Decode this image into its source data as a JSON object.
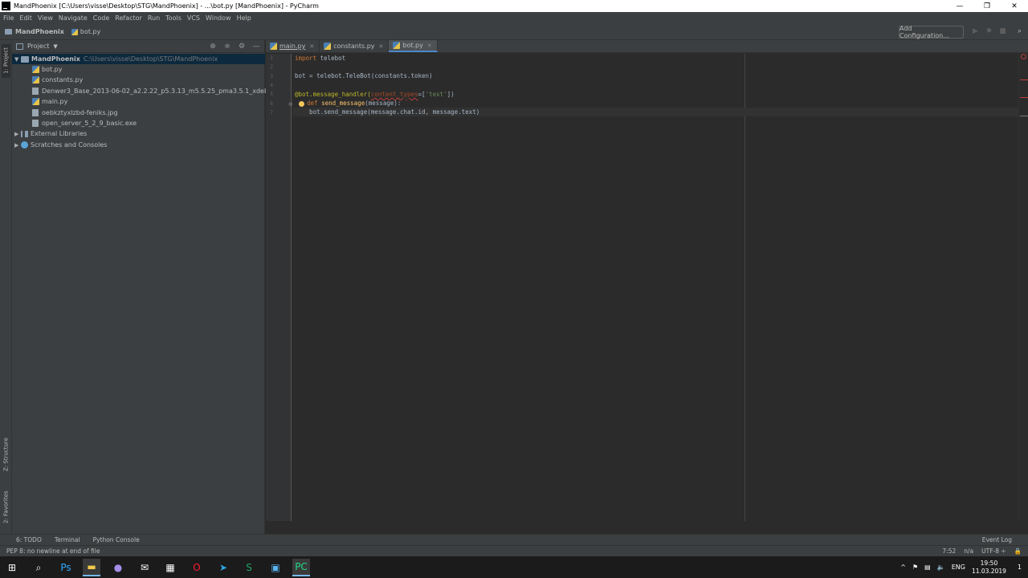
{
  "window": {
    "title": "MandPhoenix [C:\\Users\\visse\\Desktop\\STG\\MandPhoenix] - ...\\bot.py [MandPhoenix] - PyCharm",
    "minimize": "—",
    "restore": "❐",
    "close": "✕"
  },
  "menu": [
    "File",
    "Edit",
    "View",
    "Navigate",
    "Code",
    "Refactor",
    "Run",
    "Tools",
    "VCS",
    "Window",
    "Help"
  ],
  "navbar": {
    "project": "MandPhoenix",
    "file": "bot.py",
    "add_configuration": "Add Configuration..."
  },
  "left_stripe": {
    "project_tab": "1: Project",
    "structure_tab": "Z: Structure",
    "favorites_tab": "2: Favorites"
  },
  "project_panel": {
    "header": "Project",
    "tree": {
      "root_name": "MandPhoenix",
      "root_path": "C:\\Users\\visse\\Desktop\\STG\\MandPhoenix",
      "files": [
        "bot.py",
        "constants.py",
        "Denwer3_Base_2013-06-02_a2.2.22_p5.3.13_m5.5.25_pma3.5.1_xdebug.exe",
        "main.py",
        "oebkztyxlzbd-feniks.jpg",
        "open_server_5_2_9_basic.exe"
      ],
      "external_libraries": "External Libraries",
      "scratches": "Scratches and Consoles"
    }
  },
  "editor": {
    "tabs": [
      {
        "label": "main.py"
      },
      {
        "label": "constants.py"
      },
      {
        "label": "bot.py"
      }
    ],
    "line_numbers": [
      "1",
      "2",
      "3",
      "4",
      "5",
      "6",
      "7"
    ],
    "code": {
      "l1_kw": "import",
      "l1_rest": " telebot",
      "l3": "bot = telebot.TeleBot(constants.token)",
      "l5_deco": "@bot.message_handler(",
      "l5_param": "content_types",
      "l5_eq": "=[",
      "l5_str": "'text'",
      "l5_end": "])",
      "l6_kw": "def",
      "l6_fn": "send_message",
      "l6_rest": "(message):",
      "l7": "    bot.send_message(message.chat.id, message.text)"
    }
  },
  "tool_windows": {
    "todo": "6: TODO",
    "terminal": "Terminal",
    "python_console": "Python Console",
    "event_log": "Event Log"
  },
  "status": {
    "message": "PEP 8: no newline at end of file",
    "position": "7:52",
    "line_sep": "n/a",
    "encoding": "UTF-8 ÷"
  },
  "taskbar": {
    "language": "ENG",
    "time": "19:50",
    "date": "11.03.2019",
    "notification_count": "1"
  }
}
